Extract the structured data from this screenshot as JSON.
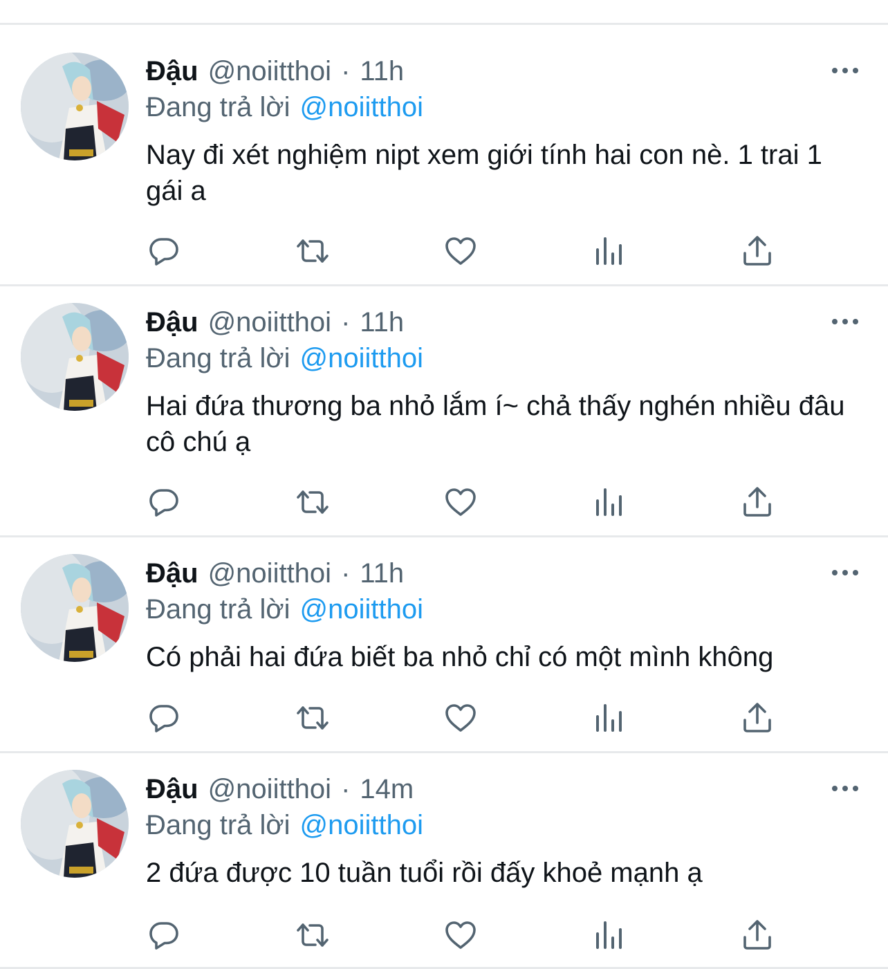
{
  "tweets": [
    {
      "author_name": "Đậu",
      "handle": "@noiitthoi",
      "separator": "·",
      "time": "11h",
      "replying_label": "Đang trả lời",
      "replying_to": "@noiitthoi",
      "text": "Nay đi xét nghiệm nipt xem giới tính hai con nè. 1 trai 1 gái a"
    },
    {
      "author_name": "Đậu",
      "handle": "@noiitthoi",
      "separator": "·",
      "time": "11h",
      "replying_label": "Đang trả lời",
      "replying_to": "@noiitthoi",
      "text": "Hai đứa thương ba nhỏ lắm í~ chả thấy nghén nhiều đâu cô chú ạ"
    },
    {
      "author_name": "Đậu",
      "handle": "@noiitthoi",
      "separator": "·",
      "time": "11h",
      "replying_label": "Đang trả lời",
      "replying_to": "@noiitthoi",
      "text": "Có phải hai đứa biết ba nhỏ chỉ có một mình không"
    },
    {
      "author_name": "Đậu",
      "handle": "@noiitthoi",
      "separator": "·",
      "time": "14m",
      "replying_label": "Đang trả lời",
      "replying_to": "@noiitthoi",
      "text": "2 đứa được 10 tuần tuổi rồi đấy khoẻ mạnh ạ"
    }
  ],
  "action_icons": [
    "reply-icon",
    "retweet-icon",
    "like-icon",
    "views-icon",
    "share-icon"
  ],
  "more_icon": "more-icon",
  "colors": {
    "text_primary": "#0f1419",
    "text_secondary": "#536471",
    "link": "#1d9bf0",
    "divider": "#e7e9eb"
  }
}
